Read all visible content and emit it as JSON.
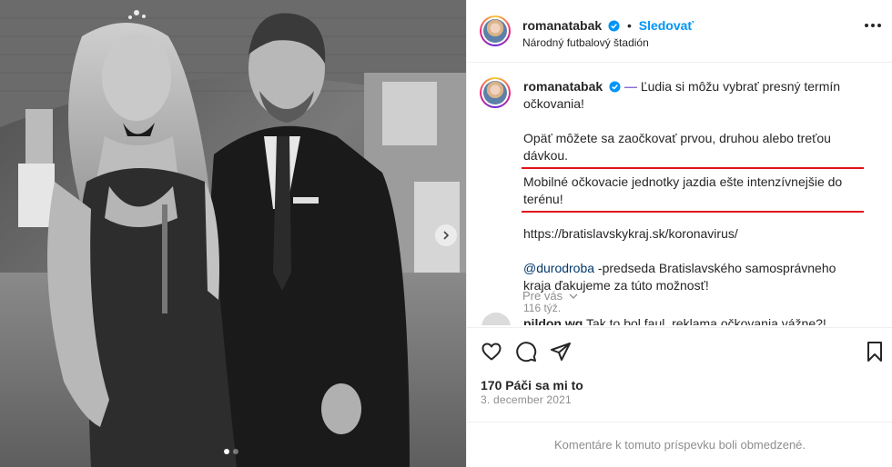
{
  "post": {
    "username": "romanatabak",
    "separator": "•",
    "follow_label": "Sledovať",
    "location": "Národný futbalový štadión",
    "caption": {
      "intro_emoji": "—",
      "intro": "Ľudia si môžu vybrať presný termín očkovania!",
      "line1": "Opäť môžete sa zaočkovať prvou, druhou alebo treťou dávkou.",
      "line2": "Mobilné očkovacie jednotky jazdia ešte intenzívnejšie do terénu!",
      "url": "https://bratislavskykraj.sk/koronavirus/",
      "mention": "@durodroba",
      "mention_text": " -predseda Bratislavského samosprávneho kraja ďakujeme za túto možnosť!"
    },
    "time_ago": "116 týž.",
    "see_translation": "Pre vás",
    "comment": {
      "username": "pildon.wg",
      "text": "Tak to bol faul, reklama očkovania vážne?!"
    },
    "likes": "170 Páči sa mi to",
    "date": "3. december 2021",
    "comments_disabled": "Komentáre k tomuto príspevku boli obmedzené."
  },
  "carousel": {
    "slides": 2,
    "active": 0
  },
  "icons": {
    "like": "heart-icon",
    "comment": "comment-icon",
    "share": "send-icon",
    "save": "bookmark-icon",
    "more": "more-icon",
    "verified": "verified-badge-icon",
    "next": "chevron-right-icon"
  },
  "colors": {
    "accent": "#0095f6",
    "link": "#00376b",
    "underline": "#e0121c",
    "muted": "#8e8e8e"
  }
}
